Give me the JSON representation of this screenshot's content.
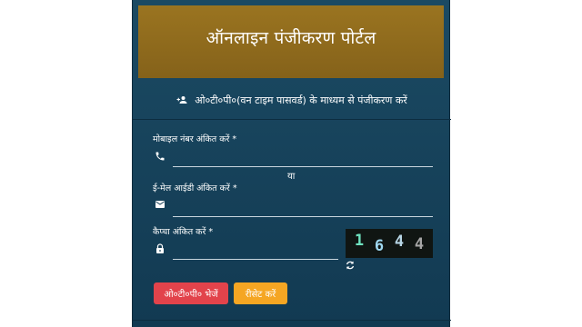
{
  "header": {
    "title": "ऑनलाइन पंजीकरण पोर्टल"
  },
  "subheader": {
    "text": "ओ०टी०पी०(वन टाइम पासवर्ड) के माध्यम से पंजीकरण करें",
    "icon": "add-user-icon"
  },
  "form": {
    "mobile": {
      "label": "मोबाइल नंबर अंकित करें *",
      "value": "",
      "icon": "phone-icon"
    },
    "or_text": "या",
    "email": {
      "label": "ई-मेल आईडी अंकित करें *",
      "value": "",
      "icon": "mail-icon"
    },
    "captcha": {
      "label": "कैप्चा अंकित करें *",
      "value": "",
      "icon": "lock-icon",
      "chars": [
        {
          "char": "1",
          "color": "#6fe3c0"
        },
        {
          "char": "6",
          "color": "#9fd8f0"
        },
        {
          "char": "4",
          "color": "#b8d6e6"
        },
        {
          "char": "4",
          "color": "#a6a6a6"
        }
      ]
    }
  },
  "buttons": {
    "send_otp": "ओ०टी०पी० भेजें",
    "reset": "रीसेट करें"
  },
  "colors": {
    "panel": "#153e56",
    "header": "#8f6a1a",
    "send_button": "#e2434b",
    "reset_button": "#f5a623"
  }
}
